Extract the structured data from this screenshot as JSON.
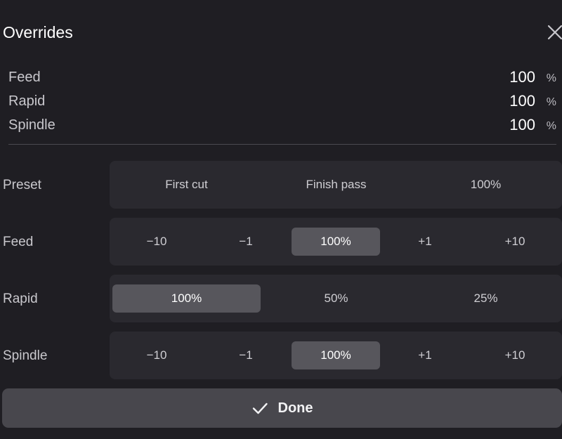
{
  "dialog": {
    "title": "Overrides",
    "close_icon": "close-icon"
  },
  "summary": [
    {
      "label": "Feed",
      "value": "100",
      "unit": "%"
    },
    {
      "label": "Rapid",
      "value": "100",
      "unit": "%"
    },
    {
      "label": "Spindle",
      "value": "100",
      "unit": "%"
    }
  ],
  "preset": {
    "label": "Preset",
    "options": [
      "First cut",
      "Finish pass",
      "100%"
    ]
  },
  "feed": {
    "label": "Feed",
    "options": [
      "−10",
      "−1",
      "100%",
      "+1",
      "+10"
    ],
    "selected": "100%"
  },
  "rapid": {
    "label": "Rapid",
    "options": [
      "100%",
      "50%",
      "25%"
    ],
    "selected": "100%"
  },
  "spindle": {
    "label": "Spindle",
    "options": [
      "−10",
      "−1",
      "100%",
      "+1",
      "+10"
    ],
    "selected": "100%"
  },
  "done_button": {
    "label": "Done",
    "icon": "check-icon"
  },
  "colors": {
    "background": "#1f1e23",
    "segment": "#2a292f",
    "active": "#57565c",
    "button": "#48474d"
  }
}
